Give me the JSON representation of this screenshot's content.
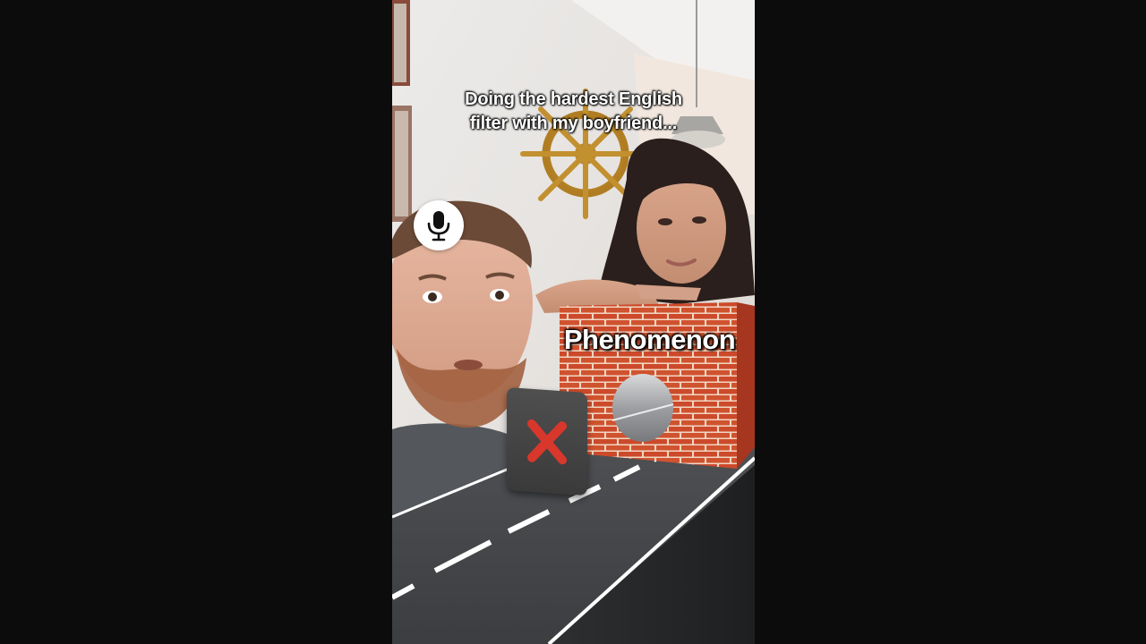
{
  "video": {
    "caption_lines": [
      "Doing the hardest English",
      "filter with my boyfriend..."
    ],
    "challenge_word": "Phenomenon",
    "mic_icon": "microphone-icon",
    "answer_indicator": "x-mark-icon",
    "colors": {
      "letterbox": "#0c0c0c",
      "brick": "#c9472a",
      "mortar": "#f2d9c4",
      "road": "#4a4c4f",
      "road_line": "#ffffff",
      "x_mark": "#d8372c",
      "badge": "#444444"
    }
  }
}
